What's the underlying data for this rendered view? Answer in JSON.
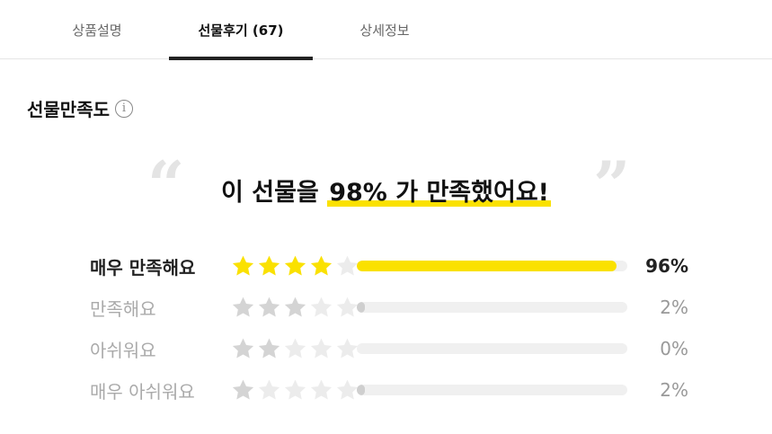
{
  "tabs": [
    {
      "label": "상품설명",
      "active": false
    },
    {
      "label": "선물후기 (67)",
      "active": true
    },
    {
      "label": "상세정보",
      "active": false
    }
  ],
  "section": {
    "title": "선물만족도",
    "info_icon": "i"
  },
  "headline": {
    "prefix": "이 선물을 ",
    "highlight": "98% 가 만족했어요!",
    "quote_open": "“",
    "quote_close": "”"
  },
  "colors": {
    "accent": "#fae100",
    "star_gold": "#fae100",
    "star_gray": "#d4d4d4",
    "star_empty": "#ececec"
  },
  "ratings": [
    {
      "label": "매우 만족해요",
      "stars": 4,
      "percent": 96,
      "percent_text": "96%",
      "top": true
    },
    {
      "label": "만족해요",
      "stars": 3,
      "percent": 2,
      "percent_text": "2%",
      "top": false
    },
    {
      "label": "아쉬워요",
      "stars": 2,
      "percent": 0,
      "percent_text": "0%",
      "top": false
    },
    {
      "label": "매우 아쉬워요",
      "stars": 1,
      "percent": 2,
      "percent_text": "2%",
      "top": false
    }
  ]
}
